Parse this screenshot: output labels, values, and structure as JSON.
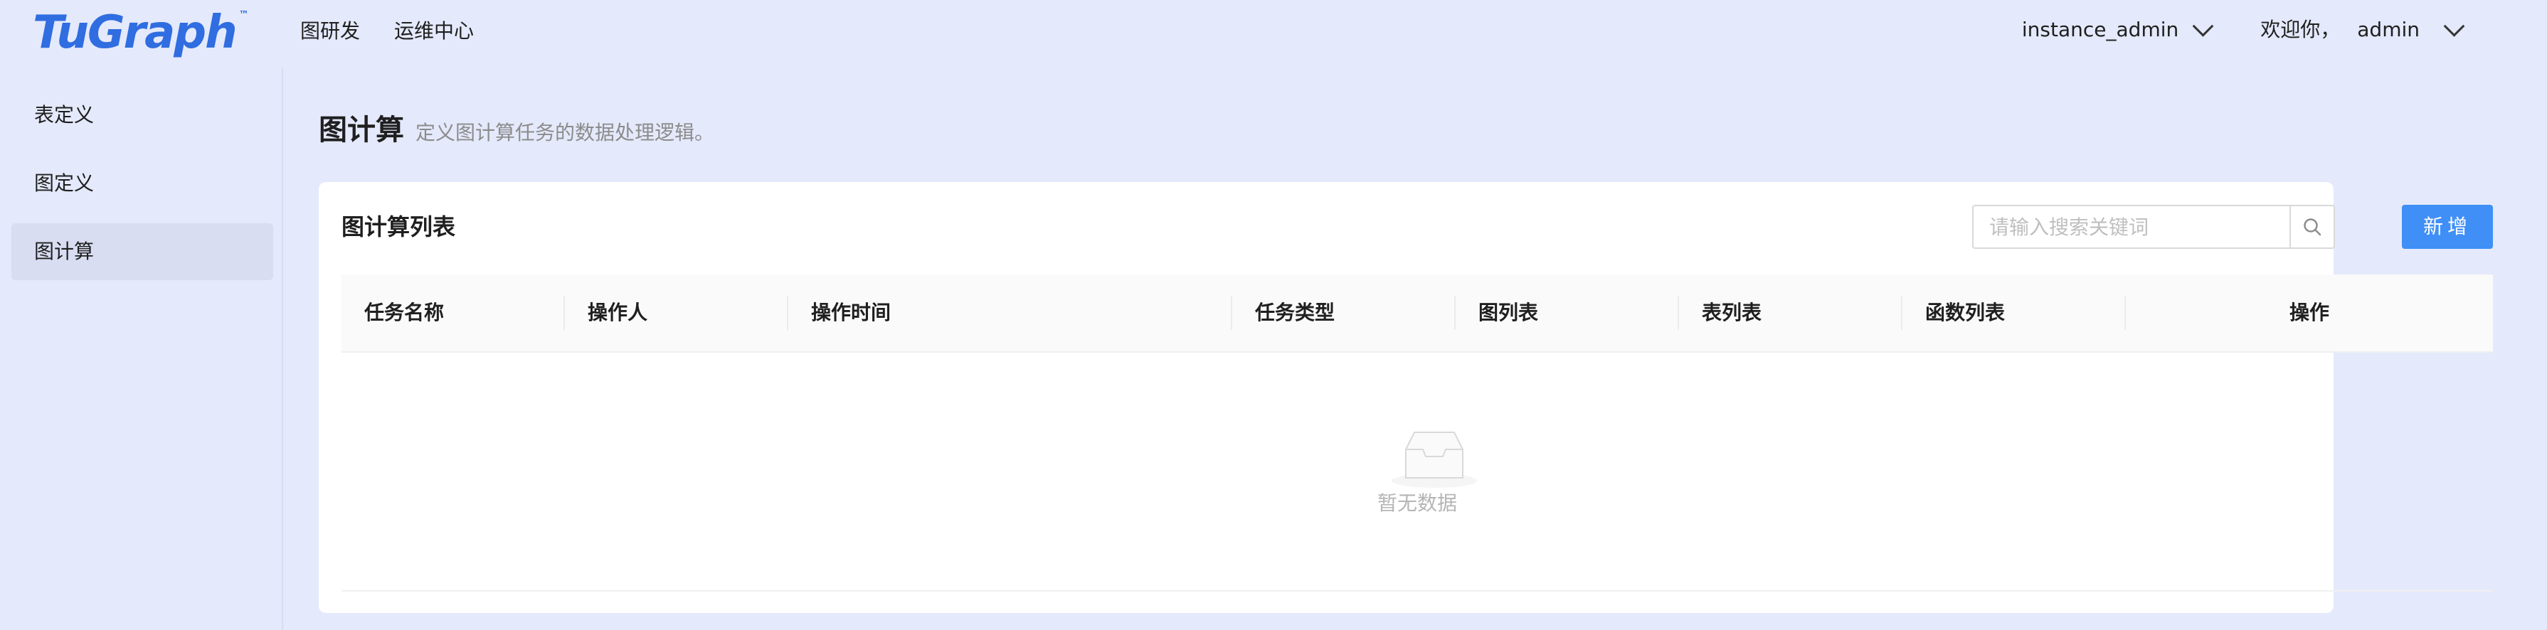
{
  "header": {
    "logo": "TuGraph",
    "logo_tm": "™",
    "nav": [
      "图研发",
      "运维中心"
    ],
    "instance": "instance_admin",
    "greeting": "欢迎你，",
    "user": "admin"
  },
  "sidebar": {
    "items": [
      {
        "label": "表定义",
        "active": false
      },
      {
        "label": "图定义",
        "active": false
      },
      {
        "label": "图计算",
        "active": true
      }
    ]
  },
  "page": {
    "title": "图计算",
    "description": "定义图计算任务的数据处理逻辑。"
  },
  "card": {
    "title": "图计算列表",
    "search_placeholder": "请输入搜索关键词",
    "add_label": "新增",
    "columns": [
      "任务名称",
      "操作人",
      "操作时间",
      "任务类型",
      "图列表",
      "表列表",
      "函数列表",
      "操作"
    ],
    "rows": [],
    "empty_text": "暂无数据"
  },
  "colors": {
    "accent": "#3f8ff7",
    "background": "#e4e9fb",
    "logo": "#2f6de0"
  }
}
